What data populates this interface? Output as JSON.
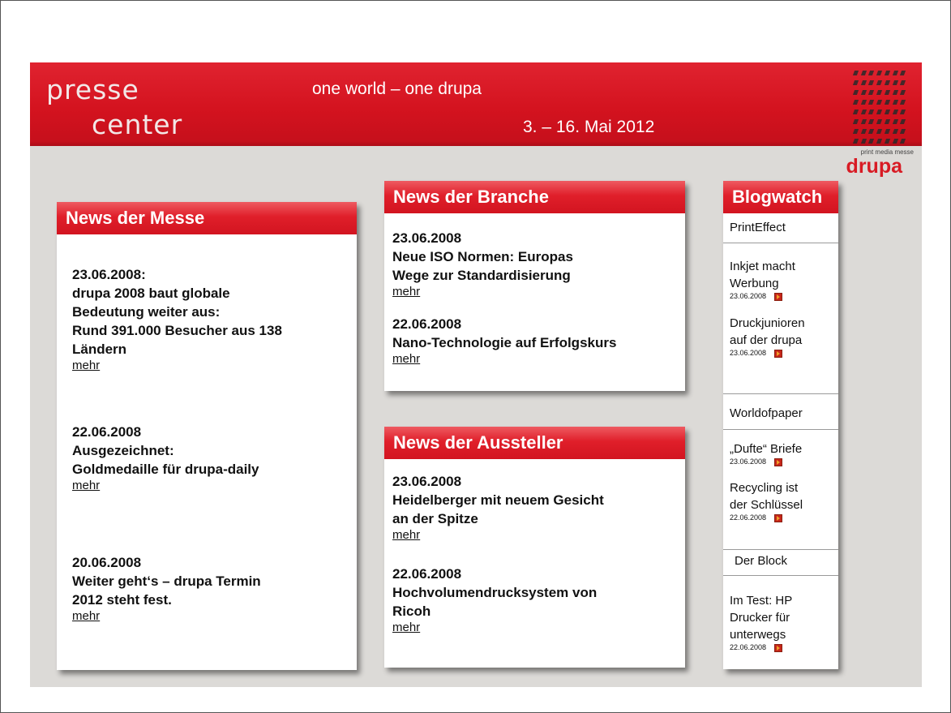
{
  "header": {
    "logo_line1": "presse",
    "logo_line2": "center",
    "slogan": "one world – one drupa",
    "date": "3. – 16. Mai 2012",
    "brand_sub": "print media messe",
    "brand_name": "drupa"
  },
  "colors": {
    "accent_red": "#d4131f",
    "background": "#dcdad7"
  },
  "news_messe": {
    "title": "News der Messe",
    "items": [
      {
        "date": "23.06.2008:",
        "lines": [
          "drupa 2008 baut globale",
          "Bedeutung weiter aus:",
          "Rund 391.000 Besucher aus 138",
          "Ländern"
        ],
        "more": "mehr"
      },
      {
        "date": "22.06.2008",
        "lines": [
          "Ausgezeichnet:",
          "Goldmedaille für drupa-daily"
        ],
        "more": "mehr"
      },
      {
        "date": "20.06.2008",
        "lines": [
          "Weiter geht‘s – drupa Termin",
          "2012 steht fest."
        ],
        "more": "mehr"
      }
    ]
  },
  "news_branche": {
    "title": "News der Branche",
    "items": [
      {
        "date": "23.06.2008",
        "lines": [
          "Neue ISO Normen: Europas",
          "Wege zur Standardisierung"
        ],
        "more": "mehr"
      },
      {
        "date": "22.06.2008",
        "lines": [
          "Nano-Technologie auf Erfolgskurs"
        ],
        "more": "mehr"
      }
    ]
  },
  "news_aussteller": {
    "title": "News der Aussteller",
    "items": [
      {
        "date": "23.06.2008",
        "lines": [
          "Heidelberger mit neuem Gesicht",
          "an der Spitze"
        ],
        "more": "mehr"
      },
      {
        "date": "22.06.2008",
        "lines": [
          "Hochvolumendrucksystem von",
          "Ricoh"
        ],
        "more": "mehr"
      }
    ]
  },
  "blogwatch": {
    "title": "Blogwatch",
    "sources": [
      {
        "name": "PrintEffect",
        "posts": [
          {
            "title": [
              "Inkjet macht",
              "Werbung"
            ],
            "date": "23.06.2008"
          },
          {
            "title": [
              "Druckjunioren",
              "auf der drupa"
            ],
            "date": "23.06.2008"
          }
        ]
      },
      {
        "name": "Worldofpaper",
        "posts": [
          {
            "title": [
              "„Dufte“ Briefe"
            ],
            "date": "23.06.2008"
          },
          {
            "title": [
              "Recycling ist",
              "der Schlüssel"
            ],
            "date": "22.06.2008"
          }
        ]
      },
      {
        "name": "Der Block",
        "posts": [
          {
            "title": [
              "Im Test: HP",
              "Drucker für",
              "unterwegs"
            ],
            "date": "22.06.2008"
          }
        ]
      }
    ]
  }
}
